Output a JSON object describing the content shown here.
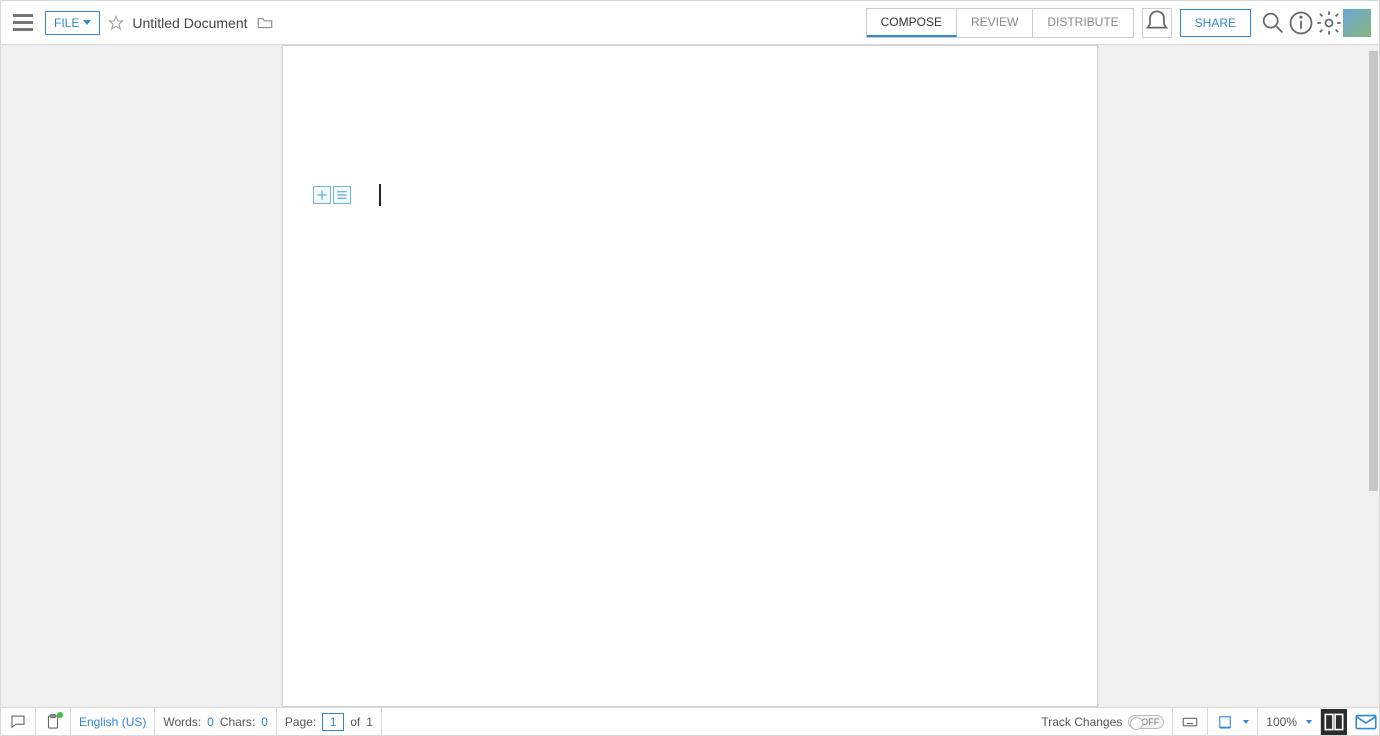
{
  "header": {
    "file_button": "FILE",
    "doc_title": "Untitled Document",
    "tabs": {
      "compose": "COMPOSE",
      "review": "REVIEW",
      "distribute": "DISTRIBUTE"
    },
    "share_button": "SHARE"
  },
  "footer": {
    "language": "English (US)",
    "words_label": "Words:",
    "words_value": "0",
    "chars_label": "Chars:",
    "chars_value": "0",
    "page_label": "Page:",
    "page_current": "1",
    "page_of": "of",
    "page_total": "1",
    "track_changes_label": "Track Changes",
    "track_changes_state": "OFF",
    "zoom": "100%"
  }
}
